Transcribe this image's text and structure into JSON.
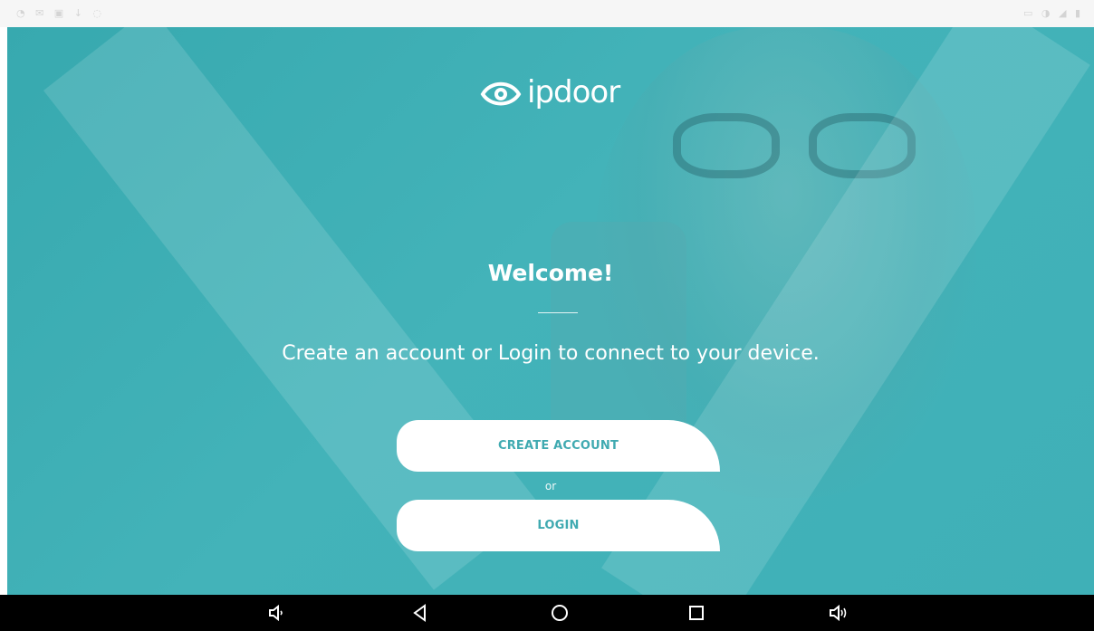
{
  "status_bar": {
    "left_icons": "◔ ✉ ▣ ↓ ◌",
    "right_icons": "▭ ◑ ◢ ▮"
  },
  "brand": {
    "name": "ipdoor",
    "logo_icon": "eye-logo-icon",
    "accent": "#40aab1",
    "background": "#3fb0b7"
  },
  "welcome": {
    "title": "Welcome!",
    "subtitle": "Create an account or Login to connect to your device."
  },
  "actions": {
    "create_account_label": "CREATE ACCOUNT",
    "or_label": "or",
    "login_label": "LOGIN"
  },
  "nav_bar": {
    "icons": [
      "volume-down-icon",
      "back-icon",
      "home-icon",
      "recent-apps-icon",
      "volume-up-icon"
    ]
  }
}
